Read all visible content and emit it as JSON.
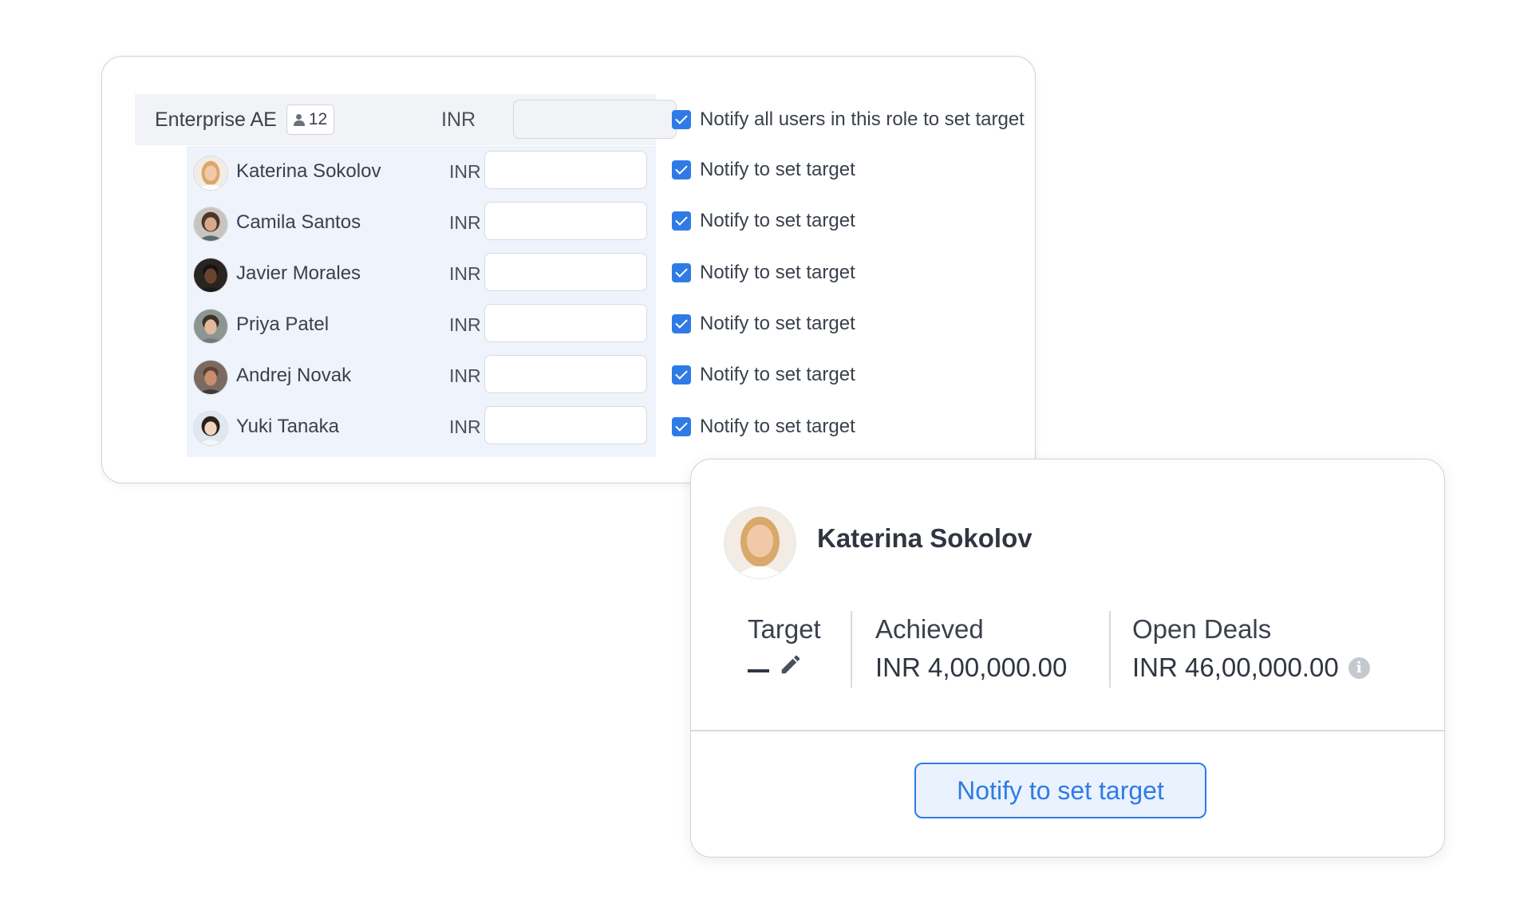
{
  "role": {
    "name": "Enterprise AE",
    "member_count": "12",
    "currency": "INR",
    "notify_label": "Notify all users in this role to set target",
    "notify_checked": true
  },
  "members": [
    {
      "name": "Katerina Sokolov",
      "currency": "INR",
      "notify_label": "Notify to set target",
      "notify_checked": true
    },
    {
      "name": "Camila Santos",
      "currency": "INR",
      "notify_label": "Notify to set target",
      "notify_checked": true
    },
    {
      "name": "Javier Morales",
      "currency": "INR",
      "notify_label": "Notify to set target",
      "notify_checked": true
    },
    {
      "name": "Priya Patel",
      "currency": "INR",
      "notify_label": "Notify to set target",
      "notify_checked": true
    },
    {
      "name": "Andrej Novak",
      "currency": "INR",
      "notify_label": "Notify to set target",
      "notify_checked": true
    },
    {
      "name": "Yuki Tanaka",
      "currency": "INR",
      "notify_label": "Notify to set target",
      "notify_checked": true
    }
  ],
  "card": {
    "name": "Katerina Sokolov",
    "target_label": "Target",
    "achieved_label": "Achieved",
    "achieved_value": "INR 4,00,000.00",
    "open_deals_label": "Open Deals",
    "open_deals_value": "INR 46,00,000.00",
    "button_label": "Notify to set target"
  },
  "colors": {
    "accent": "#2f7be6",
    "row_highlight": "#eef3fc",
    "role_row_bg": "#f1f3f6"
  }
}
